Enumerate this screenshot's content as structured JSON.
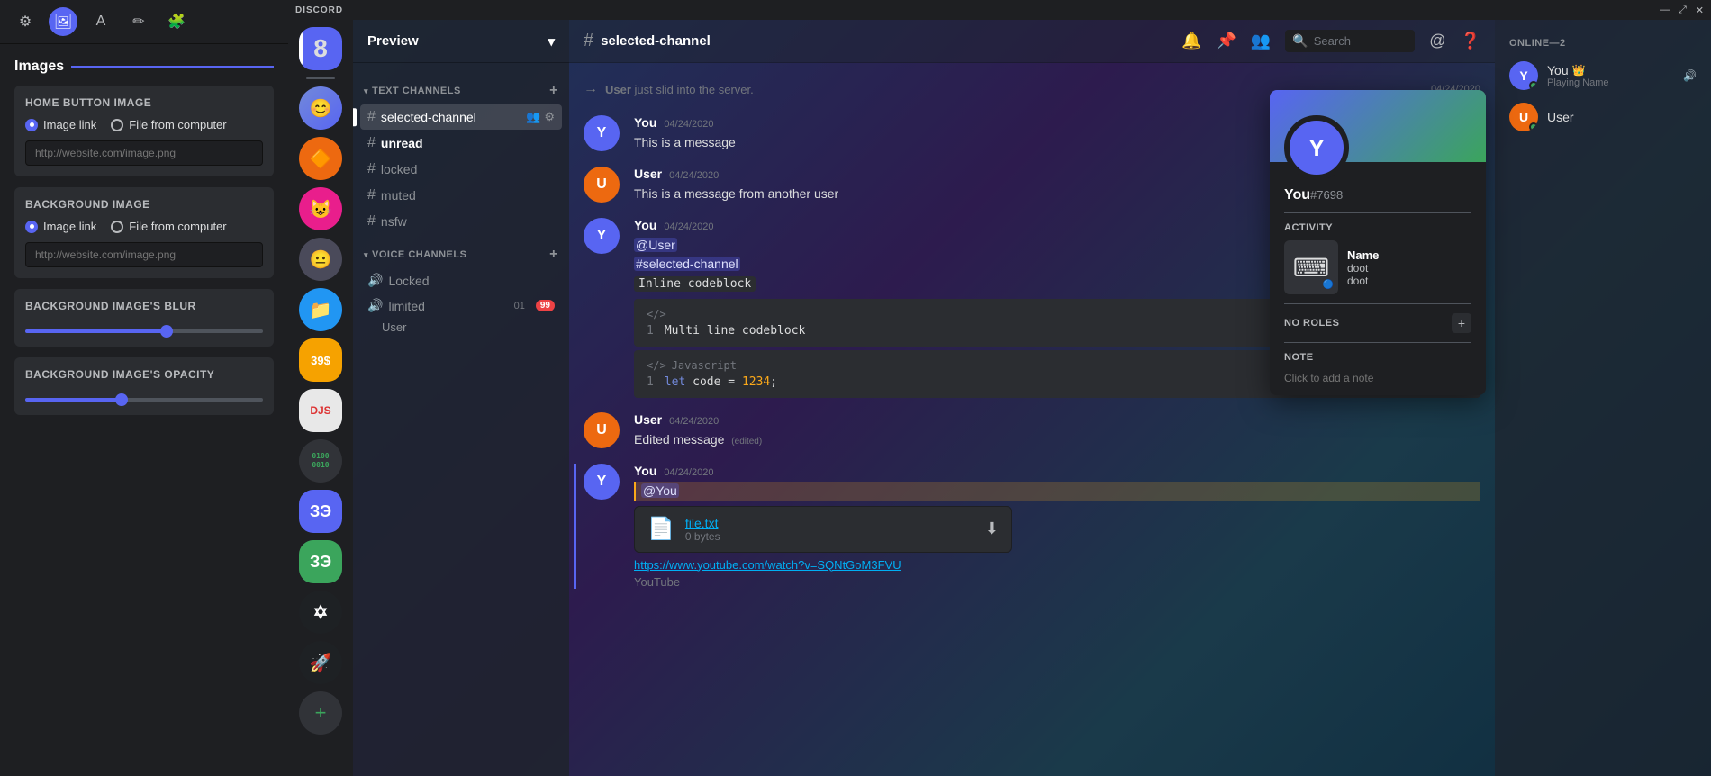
{
  "leftPanel": {
    "title": "Images",
    "toolbar": {
      "icons": [
        "⚙",
        "🖼",
        "A",
        "✏",
        "🧩"
      ]
    },
    "homeButtonImage": {
      "label": "Home button image",
      "radioOptions": [
        "Image link",
        "File from computer"
      ],
      "selectedOption": 0,
      "placeholder": "http://website.com/image.png"
    },
    "backgroundImage": {
      "label": "Background image",
      "radioOptions": [
        "Image link",
        "File from computer"
      ],
      "selectedOption": 0,
      "placeholder": "http://website.com/image.png"
    },
    "backgroundBlur": {
      "label": "Background image's blur",
      "value": 60
    },
    "backgroundOpacity": {
      "label": "Background image's opacity",
      "value": 40
    }
  },
  "discord": {
    "titlebar": {
      "logo": "DISCORD",
      "controls": [
        "—",
        "⤢",
        "✕"
      ]
    },
    "servers": [
      {
        "id": "8",
        "label": "8",
        "type": "number",
        "active": true
      },
      {
        "id": "divider"
      },
      {
        "id": "s1",
        "label": "😊",
        "type": "emoji"
      },
      {
        "id": "s2",
        "label": "🔶",
        "type": "emoji"
      },
      {
        "id": "s3",
        "label": "😺",
        "type": "emoji"
      },
      {
        "id": "s4",
        "label": "😐",
        "type": "emoji"
      },
      {
        "id": "s5",
        "label": "📁",
        "type": "emoji"
      },
      {
        "id": "s6",
        "label": "39$",
        "type": "text"
      },
      {
        "id": "s7",
        "label": "DJS",
        "type": "text"
      },
      {
        "id": "s8",
        "label": "0100\n0010",
        "type": "text"
      },
      {
        "id": "s9",
        "label": "ЗЭ",
        "type": "text"
      },
      {
        "id": "s10",
        "label": "ЗЭ",
        "type": "text"
      },
      {
        "id": "s11",
        "label": "✡",
        "type": "text"
      },
      {
        "id": "s12",
        "label": "🚀",
        "type": "text"
      },
      {
        "id": "divider2"
      },
      {
        "id": "add",
        "label": "+",
        "type": "add"
      }
    ],
    "channelSidebar": {
      "serverName": "Preview",
      "textChannels": {
        "category": "TEXT CHANNELS",
        "channels": [
          {
            "name": "selected-channel",
            "active": true,
            "icons": [
              "👥",
              "⚙"
            ]
          },
          {
            "name": "unread",
            "unread": true
          },
          {
            "name": "locked"
          },
          {
            "name": "muted"
          },
          {
            "name": "nsfw"
          }
        ]
      },
      "voiceChannels": {
        "category": "VOICE CHANNELS",
        "channels": [
          {
            "name": "Locked",
            "type": "voice"
          },
          {
            "name": "limited",
            "type": "voice",
            "badges": [
              "01",
              "99"
            ]
          }
        ],
        "users": [
          "User"
        ]
      }
    },
    "chat": {
      "channelName": "selected-channel",
      "headerIcons": [
        "🔔",
        "📌",
        "👥",
        "🔍",
        "@",
        "❓"
      ],
      "searchPlaceholder": "Search",
      "messages": [
        {
          "type": "system",
          "arrow": "→",
          "user": "User",
          "text": "just slid into the server.",
          "date": "04/24/2020"
        },
        {
          "type": "message",
          "author": "You",
          "date": "04/24/2020",
          "text": "This is a message",
          "isYou": true
        },
        {
          "type": "message",
          "author": "User",
          "date": "04/24/2020",
          "text": "This is a message from another user",
          "isYou": false
        },
        {
          "type": "message",
          "author": "You",
          "date": "04/24/2020",
          "isYou": true,
          "mentions": [
            "@User"
          ],
          "channelMentions": [
            "#selected-channel"
          ],
          "inlineCode": "Inline codeblock",
          "codeBlocks": [
            {
              "lang": "</>",
              "langName": null,
              "code": "Multi line codeblock",
              "lineNum": 1
            },
            {
              "lang": "</>",
              "langName": "Javascript",
              "code": "let code = 1234;",
              "lineNum": 1
            }
          ]
        },
        {
          "type": "message",
          "author": "User",
          "date": "04/24/2020",
          "text": "Edited message",
          "edited": true,
          "isYou": false
        },
        {
          "type": "message",
          "author": "You",
          "date": "04/24/2020",
          "isYou": true,
          "highlighted": true,
          "selfMention": "@You",
          "file": {
            "name": "file.txt",
            "size": "0 bytes"
          },
          "link": {
            "url": "https://www.youtube.com/watch?v=SQNtGoM3FVU",
            "site": "YouTube"
          }
        }
      ]
    },
    "memberList": {
      "onlineCount": 2,
      "onlineLabel": "ONLINE—2",
      "members": [
        {
          "name": "You",
          "hasCrown": true,
          "status": "online",
          "activity": "Playing Name",
          "hasSpeaker": true
        },
        {
          "name": "User",
          "status": "online",
          "hasCrown": false
        }
      ]
    },
    "profileCard": {
      "username": "You",
      "discriminator": "#7698",
      "activityLabel": "ACTIVITY",
      "activity": {
        "appName": "Name",
        "detail1": "doot",
        "detail2": "doot"
      },
      "rolesLabel": "NO ROLES",
      "noteLabel": "NOTE",
      "notePlaceholder": "Click to add a note"
    }
  }
}
